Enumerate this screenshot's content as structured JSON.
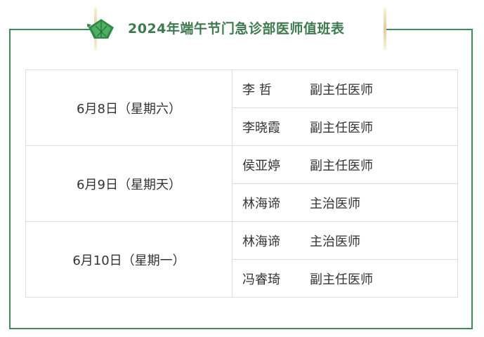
{
  "title": "2024年端午节门急诊部医师值班表",
  "colors": {
    "frame": "#3f8a5a",
    "title": "#3d7a4e",
    "zongzi_leaf": "#2f8a4a",
    "plate_bar": "#e3cc97"
  },
  "icons": {
    "decoration": "zongzi-icon"
  },
  "schedule": [
    {
      "date": "6月8日（星期六）",
      "doctors": [
        {
          "name": "李  哲",
          "title": "副主任医师"
        },
        {
          "name": "李晓霞",
          "title": "副主任医师"
        }
      ]
    },
    {
      "date": "6月9日（星期天）",
      "doctors": [
        {
          "name": "侯亚婷",
          "title": "副主任医师"
        },
        {
          "name": "林海谛",
          "title": "主治医师"
        }
      ]
    },
    {
      "date": "6月10日（星期一）",
      "doctors": [
        {
          "name": "林海谛",
          "title": "主治医师"
        },
        {
          "name": "冯睿琦",
          "title": "副主任医师"
        }
      ]
    }
  ]
}
